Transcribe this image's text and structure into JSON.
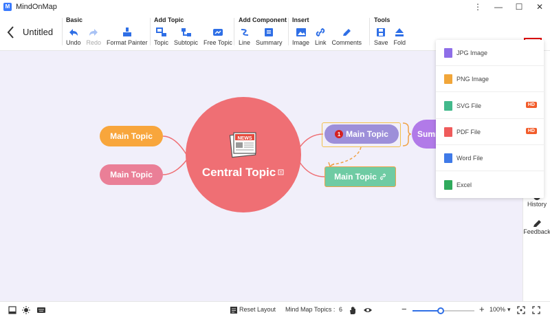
{
  "app": {
    "name": "MindOnMap",
    "logo_letter": "M"
  },
  "document": {
    "title": "Untitled"
  },
  "toolbar": {
    "groups": [
      {
        "title": "Basic",
        "items": [
          {
            "label": "Undo",
            "icon": "undo-icon"
          },
          {
            "label": "Redo",
            "icon": "redo-icon",
            "disabled": true
          },
          {
            "label": "Format Painter",
            "icon": "format-painter-icon"
          }
        ]
      },
      {
        "title": "Add Topic",
        "items": [
          {
            "label": "Topic",
            "icon": "topic-icon"
          },
          {
            "label": "Subtopic",
            "icon": "subtopic-icon"
          },
          {
            "label": "Free Topic",
            "icon": "free-topic-icon"
          }
        ]
      },
      {
        "title": "Add Component",
        "items": [
          {
            "label": "Line",
            "icon": "line-icon"
          },
          {
            "label": "Summary",
            "icon": "summary-icon"
          }
        ]
      },
      {
        "title": "Insert",
        "items": [
          {
            "label": "Image",
            "icon": "image-icon"
          },
          {
            "label": "Link",
            "icon": "link-icon"
          },
          {
            "label": "Comments",
            "icon": "comments-icon"
          }
        ]
      },
      {
        "title": "Tools",
        "items": [
          {
            "label": "Save",
            "icon": "save-icon"
          },
          {
            "label": "Fold",
            "icon": "fold-icon"
          }
        ]
      }
    ]
  },
  "map": {
    "central": "Central Topic",
    "topics": [
      "Main Topic",
      "Main Topic",
      "Main Topic",
      "Main Topic"
    ],
    "badge_count": "1",
    "summary": "Summ",
    "news_label": "NEWS"
  },
  "export_menu": {
    "items": [
      {
        "label": "JPG Image",
        "color": "#8e6ee8",
        "hd": false
      },
      {
        "label": "PNG Image",
        "color": "#f1a63a",
        "hd": false
      },
      {
        "label": "SVG File",
        "color": "#43b98c",
        "hd": true
      },
      {
        "label": "PDF File",
        "color": "#ef5b5b",
        "hd": true
      },
      {
        "label": "Word File",
        "color": "#3f7ae8",
        "hd": false
      },
      {
        "label": "Excel",
        "color": "#2faa5c",
        "hd": false
      }
    ],
    "hd_label": "HD"
  },
  "right_panel": {
    "history": "History",
    "feedback": "Feedback"
  },
  "statusbar": {
    "reset_layout": "Reset Layout",
    "topics_label": "Mind Map Topics :",
    "topics_count": "6",
    "zoom": "100%",
    "zoom_level": 0.45
  },
  "colors": {
    "accent": "#2f6fe6",
    "central": "#ef6f74",
    "highlight": "#d00000"
  }
}
